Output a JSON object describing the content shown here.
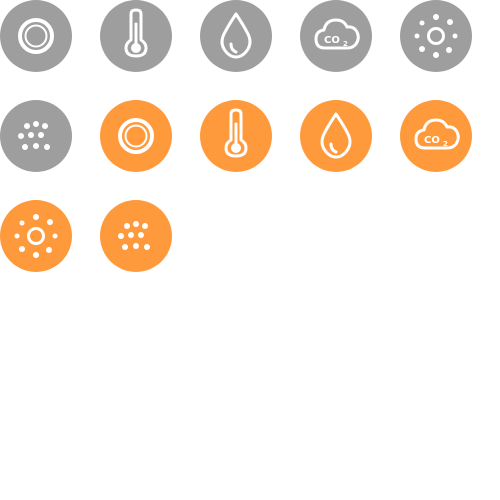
{
  "colors": {
    "gray": "#9e9e9e",
    "orange": "#ff9a3c",
    "glyph": "#ffffff"
  },
  "icons": [
    {
      "name": "ring-icon",
      "color": "gray"
    },
    {
      "name": "thermometer-icon",
      "color": "gray"
    },
    {
      "name": "water-drop-icon",
      "color": "gray"
    },
    {
      "name": "co2-cloud-icon",
      "color": "gray",
      "text": "CO",
      "sub": "2"
    },
    {
      "name": "sun-dots-icon",
      "color": "gray"
    },
    {
      "name": "particles-icon",
      "color": "gray"
    },
    {
      "name": "ring-icon",
      "color": "orange"
    },
    {
      "name": "thermometer-icon",
      "color": "orange"
    },
    {
      "name": "water-drop-icon",
      "color": "orange"
    },
    {
      "name": "co2-cloud-icon",
      "color": "orange",
      "text": "CO",
      "sub": "2"
    },
    {
      "name": "sun-dots-icon",
      "color": "orange"
    },
    {
      "name": "particles-icon",
      "color": "orange"
    }
  ]
}
